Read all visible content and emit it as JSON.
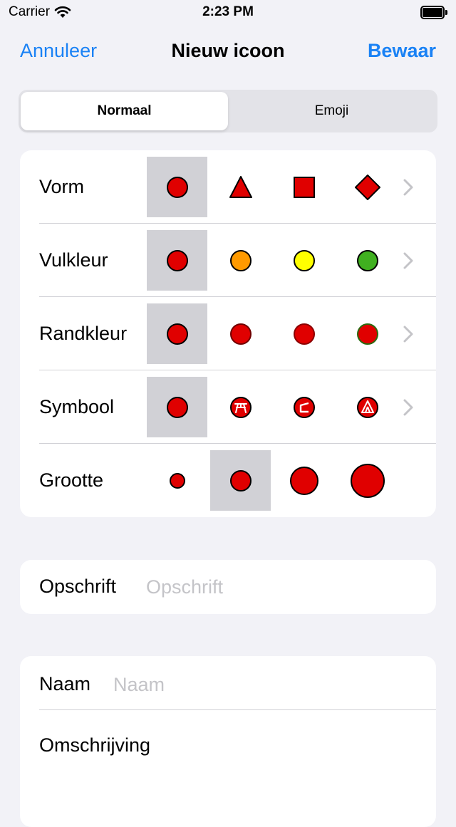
{
  "status": {
    "carrier": "Carrier",
    "time": "2:23 PM"
  },
  "nav": {
    "cancel": "Annuleer",
    "title": "Nieuw icoon",
    "save": "Bewaar"
  },
  "segments": [
    "Normaal",
    "Emoji"
  ],
  "selected_segment": "Normaal",
  "rows": {
    "shape": {
      "label": "Vorm",
      "options": [
        "circle",
        "triangle",
        "square",
        "diamond"
      ],
      "selected": "circle"
    },
    "fill": {
      "label": "Vulkleur",
      "options": [
        "#e00000",
        "#ff9a00",
        "#ffff00",
        "#40b020"
      ],
      "selected": "#e00000"
    },
    "border": {
      "label": "Randkleur",
      "options": [
        "#000000",
        "#700000",
        "#8a0000",
        "#2a6a10"
      ],
      "selected": "#000000"
    },
    "symbol": {
      "label": "Symbool",
      "options": [
        "none",
        "picnic-table-icon",
        "ramp-icon",
        "tent-icon"
      ],
      "selected": "none"
    },
    "size": {
      "label": "Grootte",
      "options": [
        "small",
        "medium",
        "large",
        "extra-large"
      ],
      "selected": "medium"
    }
  },
  "caption": {
    "label": "Opschrift",
    "placeholder": "Opschrift"
  },
  "name": {
    "label": "Naam",
    "placeholder": "Naam"
  },
  "description": {
    "label": "Omschrijving"
  },
  "colors": {
    "accent": "#1a82f5",
    "icon_red": "#e00000",
    "selected_bg": "#d1d1d6"
  }
}
